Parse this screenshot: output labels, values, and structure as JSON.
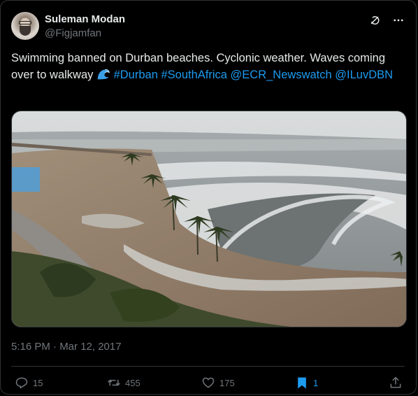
{
  "author": {
    "name": "Suleman Modan",
    "handle": "@Figjamfan"
  },
  "tweet": {
    "text_plain": "Swimming banned on Durban beaches. Cyclonic weather. Waves coming over to walkway",
    "hashtags": [
      "#Durban",
      "#SouthAfrica"
    ],
    "mentions": [
      "@ECR_Newswatch",
      "@ILuvDBN"
    ],
    "emoji": "wave-emoji"
  },
  "timestamp": "5:16 PM · Mar 12, 2017",
  "actions": {
    "replies": "15",
    "retweets": "455",
    "likes": "175",
    "bookmarks": "1"
  },
  "icons": [
    "grok-icon",
    "more-icon",
    "reply-icon",
    "retweet-icon",
    "like-icon",
    "bookmark-icon",
    "share-icon"
  ],
  "colors": {
    "background": "#000000",
    "text": "#e7e9ea",
    "secondary": "#71767b",
    "link": "#1d9bf0",
    "border": "#2f3336"
  }
}
